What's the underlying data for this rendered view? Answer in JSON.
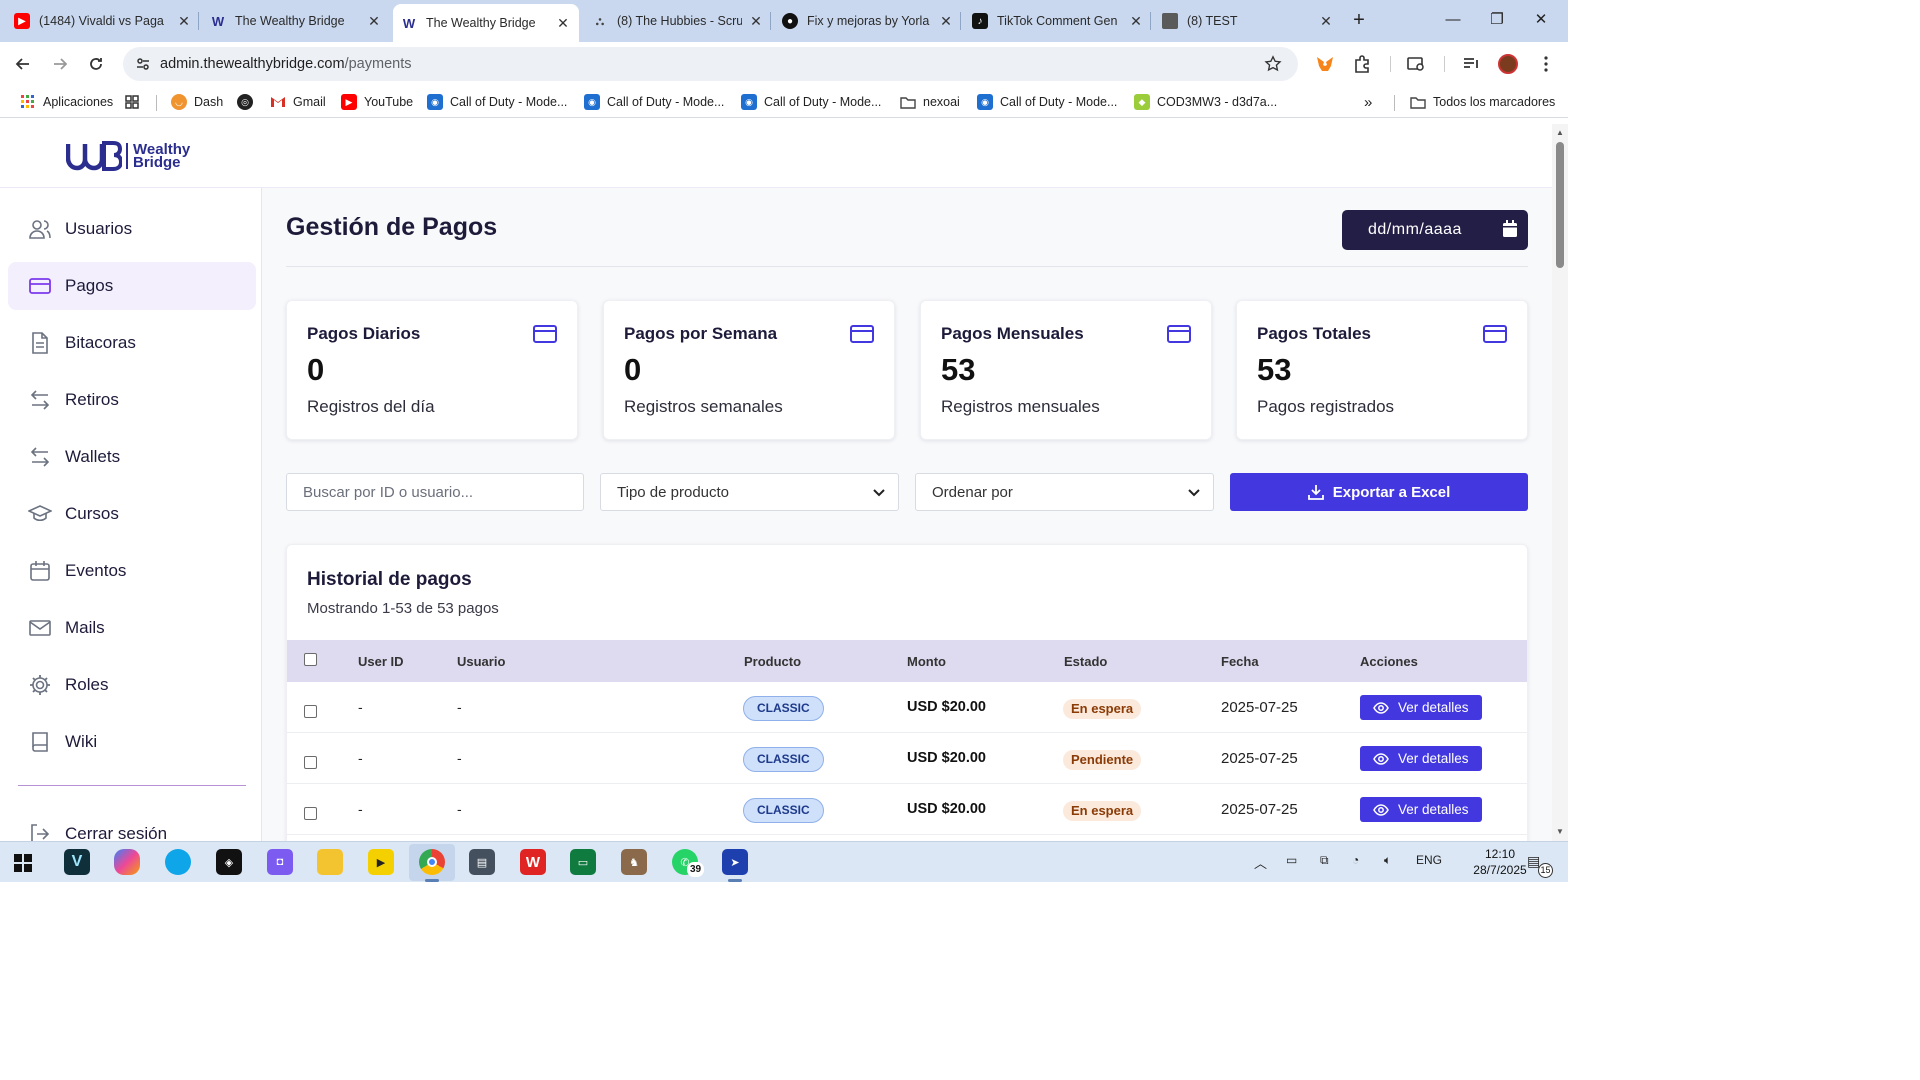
{
  "browser": {
    "tabs": [
      {
        "title": "(1484) Vivaldi vs Paga",
        "icon": "youtube-icon",
        "active": false
      },
      {
        "title": "The Wealthy Bridge",
        "icon": "wb-icon",
        "active": false
      },
      {
        "title": "The Wealthy Bridge",
        "icon": "wb-icon",
        "active": true
      },
      {
        "title": "(8) The Hubbies - Scru",
        "icon": "sitemap-icon",
        "active": false
      },
      {
        "title": "Fix y mejoras by Yorla",
        "icon": "github-icon",
        "active": false
      },
      {
        "title": "TikTok Comment Gen",
        "icon": "tiktok-icon",
        "active": false
      },
      {
        "title": "(8) TEST",
        "icon": "doc-icon",
        "active": false
      }
    ],
    "new_tab": "+",
    "url_host": "admin.thewealthybridge.com",
    "url_path": "/payments",
    "bookmarks": [
      {
        "label": "Aplicaciones",
        "icon": "apps-grid-icon"
      },
      {
        "label": "",
        "icon": "grid-icon"
      },
      {
        "label": "Dash",
        "icon": "dash-icon"
      },
      {
        "label": "",
        "icon": "globe-icon"
      },
      {
        "label": "Gmail",
        "icon": "gmail-icon"
      },
      {
        "label": "YouTube",
        "icon": "youtube-icon"
      },
      {
        "label": "Call of Duty - Mode...",
        "icon": "cod-icon"
      },
      {
        "label": "Call of Duty - Mode...",
        "icon": "cod-icon"
      },
      {
        "label": "Call of Duty - Mode...",
        "icon": "cod-icon"
      },
      {
        "label": "nexoai",
        "icon": "folder-icon"
      },
      {
        "label": "Call of Duty - Mode...",
        "icon": "cod-icon"
      },
      {
        "label": "COD3MW3 - d3d7a...",
        "icon": "android-icon"
      }
    ],
    "overflow": "»",
    "all_bookmarks": "Todos los marcadores"
  },
  "app": {
    "logo_line1": "Wealthy",
    "logo_line2": "Bridge",
    "sidebar": [
      {
        "label": "Usuarios",
        "icon": "users-icon",
        "active": false
      },
      {
        "label": "Pagos",
        "icon": "credit-card-icon",
        "active": true
      },
      {
        "label": "Bitacoras",
        "icon": "document-icon",
        "active": false
      },
      {
        "label": "Retiros",
        "icon": "transfer-icon",
        "active": false
      },
      {
        "label": "Wallets",
        "icon": "transfer-icon",
        "active": false
      },
      {
        "label": "Cursos",
        "icon": "graduation-cap-icon",
        "active": false
      },
      {
        "label": "Eventos",
        "icon": "calendar-icon",
        "active": false
      },
      {
        "label": "Mails",
        "icon": "mail-icon",
        "active": false
      },
      {
        "label": "Roles",
        "icon": "gear-icon",
        "active": false
      },
      {
        "label": "Wiki",
        "icon": "book-icon",
        "active": false
      }
    ],
    "logout": "Cerrar sesión",
    "page_title": "Gestión de Pagos",
    "date_placeholder": "dd/mm/aaaa",
    "cards": [
      {
        "title": "Pagos Diarios",
        "value": "0",
        "subtitle": "Registros del día"
      },
      {
        "title": "Pagos por Semana",
        "value": "0",
        "subtitle": "Registros semanales"
      },
      {
        "title": "Pagos Mensuales",
        "value": "53",
        "subtitle": "Registros mensuales"
      },
      {
        "title": "Pagos Totales",
        "value": "53",
        "subtitle": "Pagos registrados"
      }
    ],
    "filters": {
      "search_placeholder": "Buscar por ID o usuario...",
      "product_select": "Tipo de producto",
      "order_select": "Ordenar por",
      "export_label": "Exportar a Excel"
    },
    "history": {
      "title": "Historial de pagos",
      "subtitle": "Mostrando 1-53 de 53 pagos",
      "columns": [
        "User ID",
        "Usuario",
        "Producto",
        "Monto",
        "Estado",
        "Fecha",
        "Acciones"
      ],
      "rows": [
        {
          "user_id": "-",
          "usuario": "-",
          "producto": "CLASSIC",
          "monto": "USD $20.00",
          "estado": "En espera",
          "fecha": "2025-07-25",
          "accion": "Ver detalles"
        },
        {
          "user_id": "-",
          "usuario": "-",
          "producto": "CLASSIC",
          "monto": "USD $20.00",
          "estado": "Pendiente",
          "fecha": "2025-07-25",
          "accion": "Ver detalles"
        },
        {
          "user_id": "-",
          "usuario": "-",
          "producto": "CLASSIC",
          "monto": "USD $20.00",
          "estado": "En espera",
          "fecha": "2025-07-25",
          "accion": "Ver detalles"
        }
      ]
    },
    "colors": {
      "accent": "#4338e0",
      "dark": "#231e45",
      "sidebar_active_bg": "#f3effd",
      "pill_bg": "#cfe0fb",
      "status_bg": "#fbe9dc"
    }
  },
  "taskbar": {
    "language": "ENG",
    "time": "12:10",
    "date": "28/7/2025",
    "whatsapp_badge": "39",
    "notifications": "15"
  }
}
